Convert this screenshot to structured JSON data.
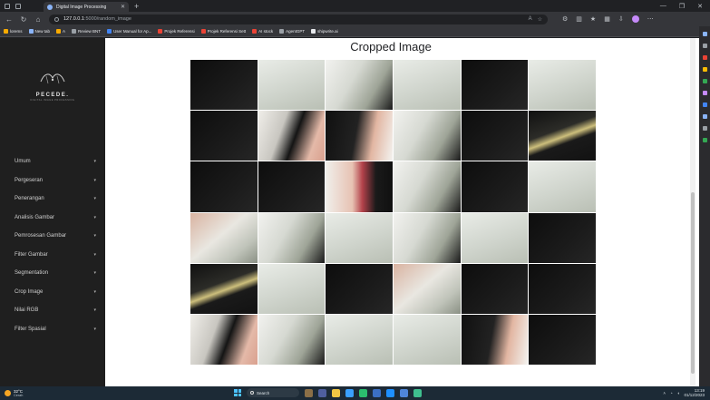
{
  "browser": {
    "tab_title": "Digital Image Processing",
    "url_host": "127.0.0.1",
    "url_path": ":5000/random_image",
    "bookmarks": [
      {
        "label": "lorems",
        "color": "#f9ab00"
      },
      {
        "label": "New tab",
        "color": "#8ab4f8"
      },
      {
        "label": "A",
        "color": "#f9ab00"
      },
      {
        "label": "Review BNT",
        "color": "#9aa0a6"
      },
      {
        "label": "User Manual for Ap...",
        "color": "#4285f4"
      },
      {
        "label": "Projek Referensi",
        "color": "#ea4335"
      },
      {
        "label": "Projek Referensi Sett",
        "color": "#ea4335"
      },
      {
        "label": "AI stock",
        "color": "#ea4335"
      },
      {
        "label": "AgentGPT",
        "color": "#9aa0a6"
      },
      {
        "label": "shipwrite.ai",
        "color": "#e8eaed"
      }
    ]
  },
  "sidebar": {
    "logo_name": "PECEDE.",
    "logo_sub": "DIGITAL IMAGE PROCESSING",
    "items": [
      {
        "label": "Umum"
      },
      {
        "label": "Pergeseran"
      },
      {
        "label": "Penerangan"
      },
      {
        "label": "Analisis Gambar"
      },
      {
        "label": "Pemrosesan Gambar"
      },
      {
        "label": "Filter Gambar"
      },
      {
        "label": "Segmentation"
      },
      {
        "label": "Crop Image"
      },
      {
        "label": "Nilai RGB"
      },
      {
        "label": "Filter Spasial"
      }
    ]
  },
  "content": {
    "title": "Cropped Image",
    "tiles": [
      "dark",
      "light",
      "hood",
      "light",
      "dark",
      "light",
      "dark",
      "face",
      "face2",
      "hood",
      "dark",
      "shine",
      "dark",
      "dark",
      "lip",
      "hood",
      "dark",
      "light",
      "face3",
      "hood",
      "light",
      "hood",
      "light",
      "dark",
      "shine",
      "light",
      "dark",
      "face3",
      "dark",
      "dark",
      "face",
      "hood",
      "light",
      "light",
      "face2",
      "dark"
    ]
  },
  "taskbar": {
    "temp": "32°C",
    "condition": "Cerah",
    "search_label": "Search",
    "time": "13:19",
    "date": "01/12/2023",
    "apps": [
      "#8b6f47",
      "#4f5f9f",
      "#f2c744",
      "#3aa0ff",
      "#2bbd6e",
      "#3b6fc2",
      "#1e90ff",
      "#4f86d9",
      "#3fbf8f"
    ]
  },
  "colors": {
    "sidebar_bg": "#1f1f1f",
    "page_bg": "#ffffff",
    "taskbar_bg": "#1c2a36"
  }
}
